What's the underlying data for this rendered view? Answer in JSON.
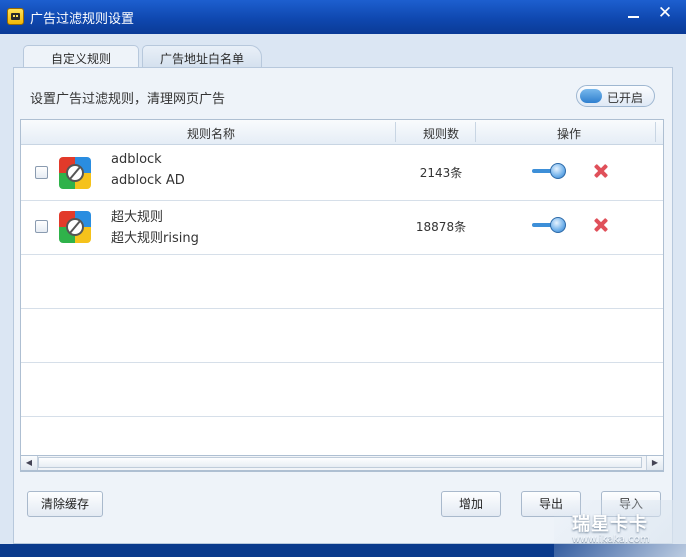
{
  "window": {
    "title": "广告过滤规则设置",
    "min_icon": "minimize-icon",
    "close_glyph": "✕"
  },
  "tabs": [
    {
      "label": "自定义规则",
      "active": true
    },
    {
      "label": "广告地址白名单",
      "active": false
    }
  ],
  "description": "设置广告过滤规则，清理网页广告",
  "toggle": {
    "label": "已开启",
    "on": true
  },
  "table": {
    "headers": {
      "name": "规则名称",
      "count": "规则数",
      "action": "操作"
    },
    "rows": [
      {
        "name_line1": "adblock",
        "name_line2": "adblock AD",
        "count": "2143条",
        "checked": false,
        "enabled": true
      },
      {
        "name_line1": "超大规则",
        "name_line2": "超大规则rising",
        "count": "18878条",
        "checked": false,
        "enabled": true
      }
    ],
    "empty_rows": 4
  },
  "scrollbar": {
    "left_glyph": "◀",
    "right_glyph": "▶"
  },
  "buttons": {
    "clear_cache": "清除缓存",
    "add": "增加",
    "export": "导出",
    "import": "导入"
  },
  "watermark": {
    "title": "瑞星卡卡",
    "url": "www.ikaka.com"
  },
  "colors": {
    "titlebar": "#1252bf",
    "accent": "#3d8fd8",
    "delete": "#e0505a"
  }
}
